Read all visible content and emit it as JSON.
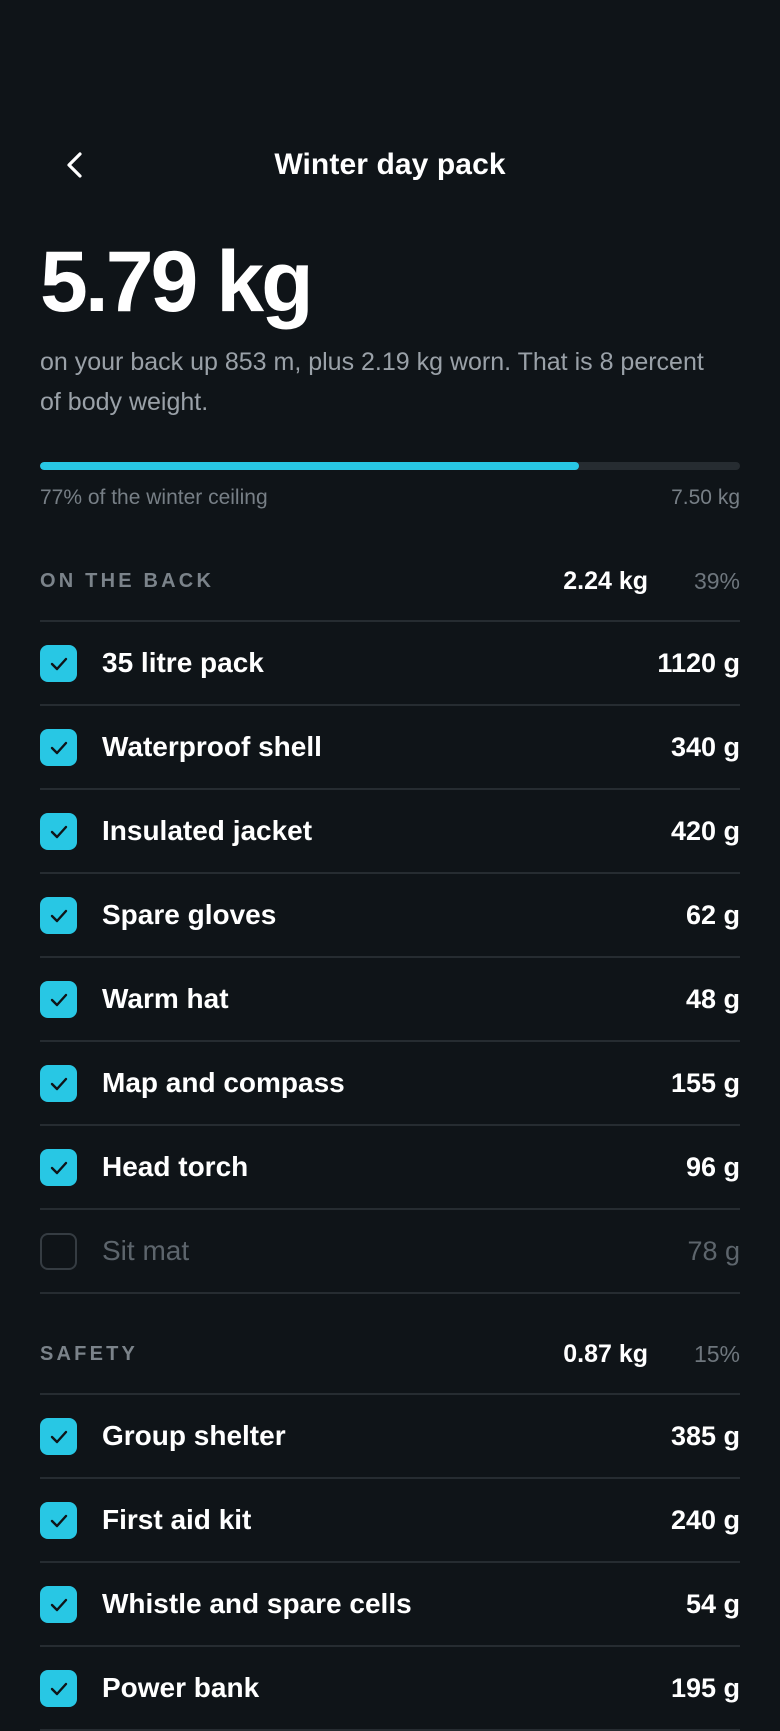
{
  "header": {
    "title": "Winter day pack",
    "back_icon": "chevron-left-icon"
  },
  "summary": {
    "total_weight": "5.79 kg",
    "subtitle": "on your back up 853 m, plus 2.19 kg worn. That is 8 percent of body weight.",
    "progress_fraction": 0.77,
    "progress_caption": "77% of the winter ceiling",
    "ceiling": "7.50 kg",
    "accent_color": "#28c7e4"
  },
  "sections": [
    {
      "label": "ON THE BACK",
      "total": "2.24 kg",
      "percent": "39%",
      "items": [
        {
          "name": "35 litre pack",
          "weight": "1120 g",
          "checked": true
        },
        {
          "name": "Waterproof shell",
          "weight": "340 g",
          "checked": true
        },
        {
          "name": "Insulated jacket",
          "weight": "420 g",
          "checked": true
        },
        {
          "name": "Spare gloves",
          "weight": "62 g",
          "checked": true
        },
        {
          "name": "Warm hat",
          "weight": "48 g",
          "checked": true
        },
        {
          "name": "Map and compass",
          "weight": "155 g",
          "checked": true
        },
        {
          "name": "Head torch",
          "weight": "96 g",
          "checked": true
        },
        {
          "name": "Sit mat",
          "weight": "78 g",
          "checked": false
        }
      ]
    },
    {
      "label": "SAFETY",
      "total": "0.87 kg",
      "percent": "15%",
      "items": [
        {
          "name": "Group shelter",
          "weight": "385 g",
          "checked": true
        },
        {
          "name": "First aid kit",
          "weight": "240 g",
          "checked": true
        },
        {
          "name": "Whistle and spare cells",
          "weight": "54 g",
          "checked": true
        },
        {
          "name": "Power bank",
          "weight": "195 g",
          "checked": true
        }
      ]
    }
  ]
}
